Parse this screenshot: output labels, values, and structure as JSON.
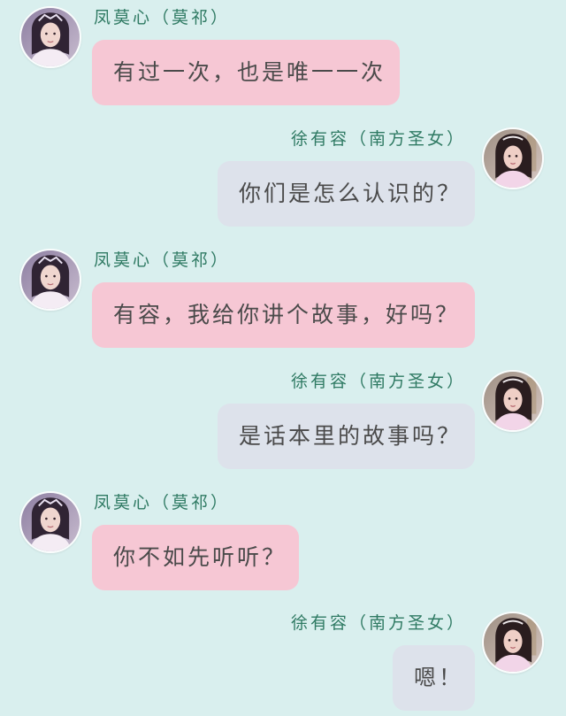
{
  "theme": {
    "background": "#d9efee",
    "left_bubble": "#f6c7d4",
    "right_bubble": "#dde2eb",
    "name_color": "#2f7a63",
    "text_color": "#4a4a4a"
  },
  "participants": {
    "left": {
      "name": "凤莫心（莫祁）",
      "avatar_icon": "left-avatar"
    },
    "right": {
      "name": "徐有容（南方圣女）",
      "avatar_icon": "right-avatar"
    }
  },
  "messages": [
    {
      "side": "left",
      "sender": "凤莫心（莫祁）",
      "text": "有过一次，也是唯一一次"
    },
    {
      "side": "right",
      "sender": "徐有容（南方圣女）",
      "text": "你们是怎么认识的？"
    },
    {
      "side": "left",
      "sender": "凤莫心（莫祁）",
      "text": "有容，我给你讲个故事，好吗？"
    },
    {
      "side": "right",
      "sender": "徐有容（南方圣女）",
      "text": "是话本里的故事吗？"
    },
    {
      "side": "left",
      "sender": "凤莫心（莫祁）",
      "text": "你不如先听听？"
    },
    {
      "side": "right",
      "sender": "徐有容（南方圣女）",
      "text": "嗯！"
    }
  ]
}
